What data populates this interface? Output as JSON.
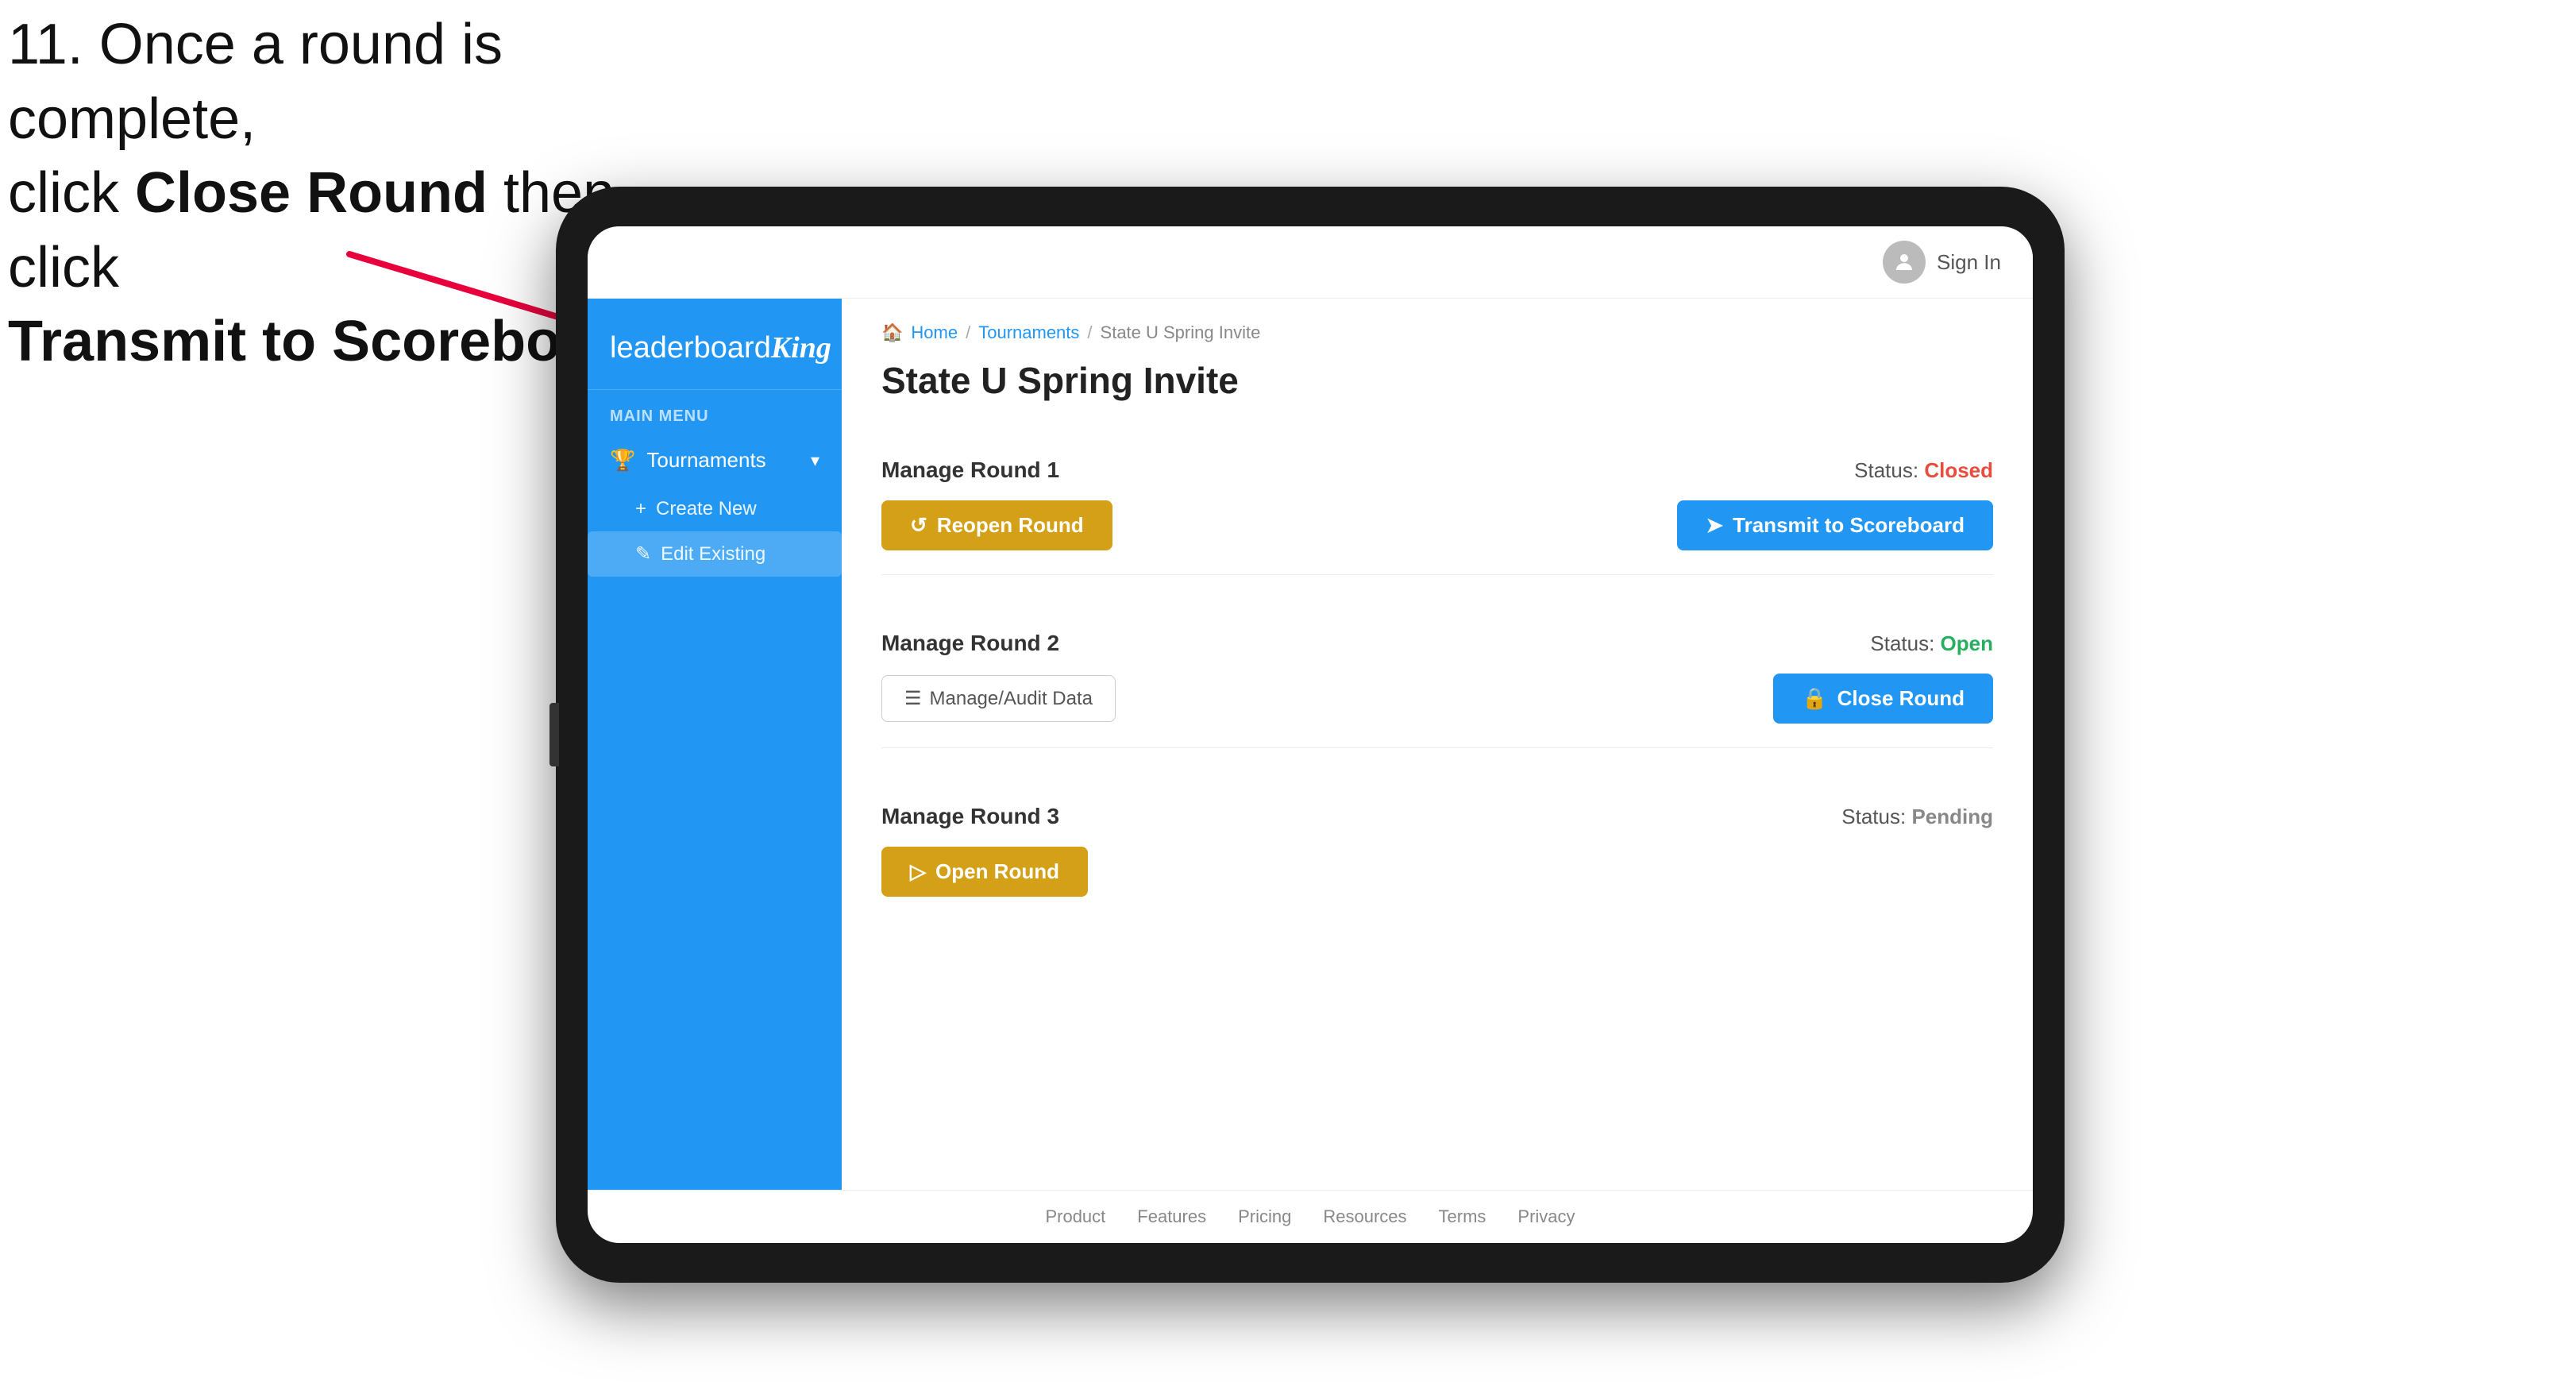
{
  "instruction": {
    "line1": "11. Once a round is complete,",
    "line2": "click ",
    "bold1": "Close Round",
    "line3": " then click",
    "bold2": "Transmit to Scoreboard."
  },
  "header": {
    "sign_in_label": "Sign In"
  },
  "sidebar": {
    "logo": "leaderboard",
    "logo_king": "King",
    "main_menu_label": "MAIN MENU",
    "tournaments_label": "Tournaments",
    "create_new_label": "Create New",
    "edit_existing_label": "Edit Existing"
  },
  "breadcrumb": {
    "home": "Home",
    "tournaments": "Tournaments",
    "current": "State U Spring Invite"
  },
  "page": {
    "title": "State U Spring Invite"
  },
  "rounds": [
    {
      "id": "round1",
      "title": "Manage Round 1",
      "status_label": "Status:",
      "status_value": "Closed",
      "status_type": "closed",
      "left_button": "Reopen Round",
      "right_button": "Transmit to Scoreboard"
    },
    {
      "id": "round2",
      "title": "Manage Round 2",
      "status_label": "Status:",
      "status_value": "Open",
      "status_type": "open",
      "left_button": "Manage/Audit Data",
      "right_button": "Close Round"
    },
    {
      "id": "round3",
      "title": "Manage Round 3",
      "status_label": "Status:",
      "status_value": "Pending",
      "status_type": "pending",
      "left_button": "Open Round",
      "right_button": null
    }
  ],
  "footer": {
    "links": [
      "Product",
      "Features",
      "Pricing",
      "Resources",
      "Terms",
      "Privacy"
    ]
  },
  "colors": {
    "blue": "#2196f3",
    "gold": "#d4a017",
    "red": "#e74c3c",
    "green": "#27ae60"
  }
}
